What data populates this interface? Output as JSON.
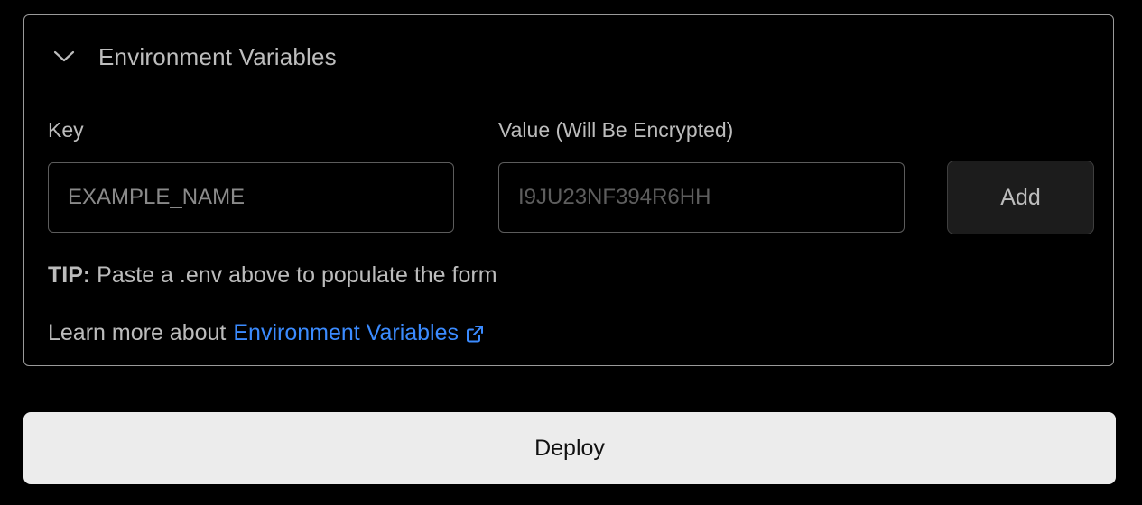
{
  "env_section": {
    "title": "Environment Variables",
    "expanded": true,
    "chevron_icon": "chevron-down-icon",
    "key_label": "Key",
    "key_placeholder": "EXAMPLE_NAME",
    "value_label": "Value (Will Be Encrypted)",
    "value_placeholder": "I9JU23NF394R6HH",
    "add_label": "Add",
    "tip_prefix": "TIP:",
    "tip_text": "Paste a .env above to populate the form",
    "learn_prefix": "Learn more about",
    "learn_link_text": "Environment Variables",
    "learn_link_icon": "external-link-icon"
  },
  "deploy": {
    "label": "Deploy"
  },
  "colors": {
    "background": "#000000",
    "link": "#3b8bff",
    "deploy_button_bg": "#ececec",
    "add_button_bg": "#1c1c1c"
  }
}
